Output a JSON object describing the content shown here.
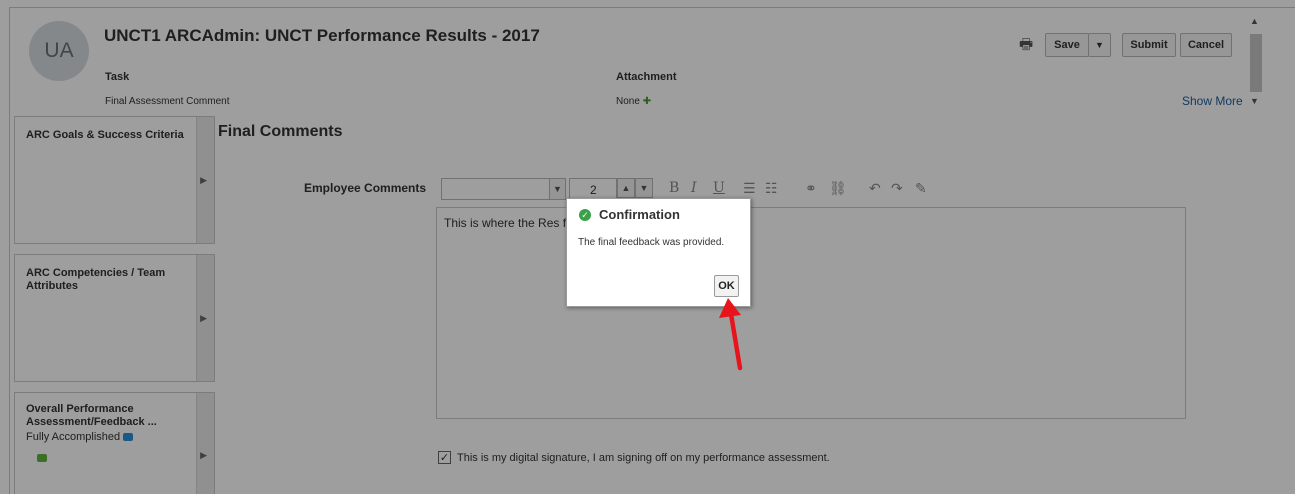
{
  "header": {
    "avatar_initials": "UA",
    "title": "UNCT1 ARCAdmin: UNCT Performance Results - 2017",
    "task_label": "Task",
    "task_value": "Final Assessment Comment",
    "attachment_label": "Attachment",
    "attachment_value": "None",
    "show_more": "Show More"
  },
  "toolbar": {
    "save_label": "Save",
    "submit_label": "Submit",
    "cancel_label": "Cancel"
  },
  "sidebar": {
    "items": [
      {
        "label": "ARC Goals & Success Criteria",
        "sub": ""
      },
      {
        "label": "ARC Competencies / Team Attributes",
        "sub": ""
      },
      {
        "label": "Overall Performance Assessment/Feedback ...",
        "sub": "Fully Accomplished"
      }
    ]
  },
  "main": {
    "section_title": "Final Comments",
    "employee_comments_label": "Employee Comments",
    "font_size_value": "2",
    "editor_text": "This is where the Res                                    f of UNCT on performance results",
    "signature_text": "This is my digital signature, I am signing off on my performance assessment."
  },
  "dialog": {
    "title": "Confirmation",
    "message": "The final feedback was provided.",
    "ok_label": "OK"
  },
  "colors": {
    "overlay": "#000000",
    "confirm_green": "#3aa14a",
    "arrow_red": "#e8141b",
    "link_blue": "#1f5c99"
  }
}
